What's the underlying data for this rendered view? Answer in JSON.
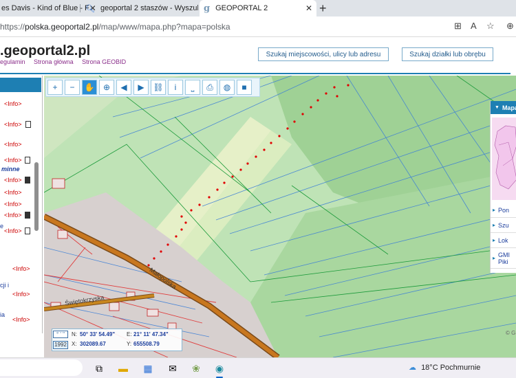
{
  "browser": {
    "tabs": [
      {
        "label": "es Davis - Kind of Blue - F",
        "close": "✕"
      },
      {
        "label": "geoportal 2 staszów - Wyszukaj",
        "close": "✕"
      },
      {
        "label": "GEOPORTAL 2",
        "close": "✕"
      }
    ],
    "new_tab": "+",
    "url_scheme": "https://",
    "url_host": "polska.geoportal2.pl",
    "url_path": "/map/www/mapa.php?mapa=polska"
  },
  "site": {
    "brand": ".geoportal2.pl",
    "links": [
      "egulamin",
      "Strona główna",
      "Strona GEOBID"
    ],
    "search_place_button": "Szukaj miejscowości, ulicy lub adresu",
    "search_parcel_button": "Szukaj działki lub obrębu"
  },
  "left_panel": {
    "info_label": "<Info>",
    "italic_text": "minne",
    "side_fragments": [
      "e",
      "cji i",
      "ia"
    ]
  },
  "toolbar": {
    "icons": [
      "zoom-in-icon",
      "zoom-out-icon",
      "pan-hand-icon",
      "zoom-box-icon",
      "back-arrow-icon",
      "forward-arrow-icon",
      "link-icon",
      "info-icon",
      "measure-icon",
      "print-icon",
      "globe-icon",
      "camera-icon"
    ],
    "glyphs": [
      "+",
      "−",
      "✋",
      "⊕",
      "◀",
      "▶",
      "⛓",
      "i",
      "⎵",
      "⎙",
      "◍",
      "■"
    ]
  },
  "map": {
    "streets": [
      "Małopolska",
      "Świętokrzyska"
    ],
    "copyright": "© G"
  },
  "coords": {
    "format_selector": "° ' \"",
    "year": "1992",
    "n_label": "N:",
    "n_value": "50° 33' 54.49\"",
    "e_label": "E:",
    "e_value": "21° 11' 47.34\"",
    "x_label": "X:",
    "x_value": "302089.67",
    "y_label": "Y:",
    "y_value": "655508.79"
  },
  "right_panel": {
    "header": "Mapa",
    "items": [
      "Pon",
      "Szu",
      "Lok",
      "GMI Piki"
    ]
  },
  "taskbar": {
    "weather_temp": "18°C",
    "weather_desc": "Pochmurnie"
  },
  "colors": {
    "accent": "#1e7fb3",
    "info_red": "#cc0000",
    "map_green": "#bfe3b6",
    "road_brown": "#b5651d",
    "dot_red": "#e00000"
  }
}
